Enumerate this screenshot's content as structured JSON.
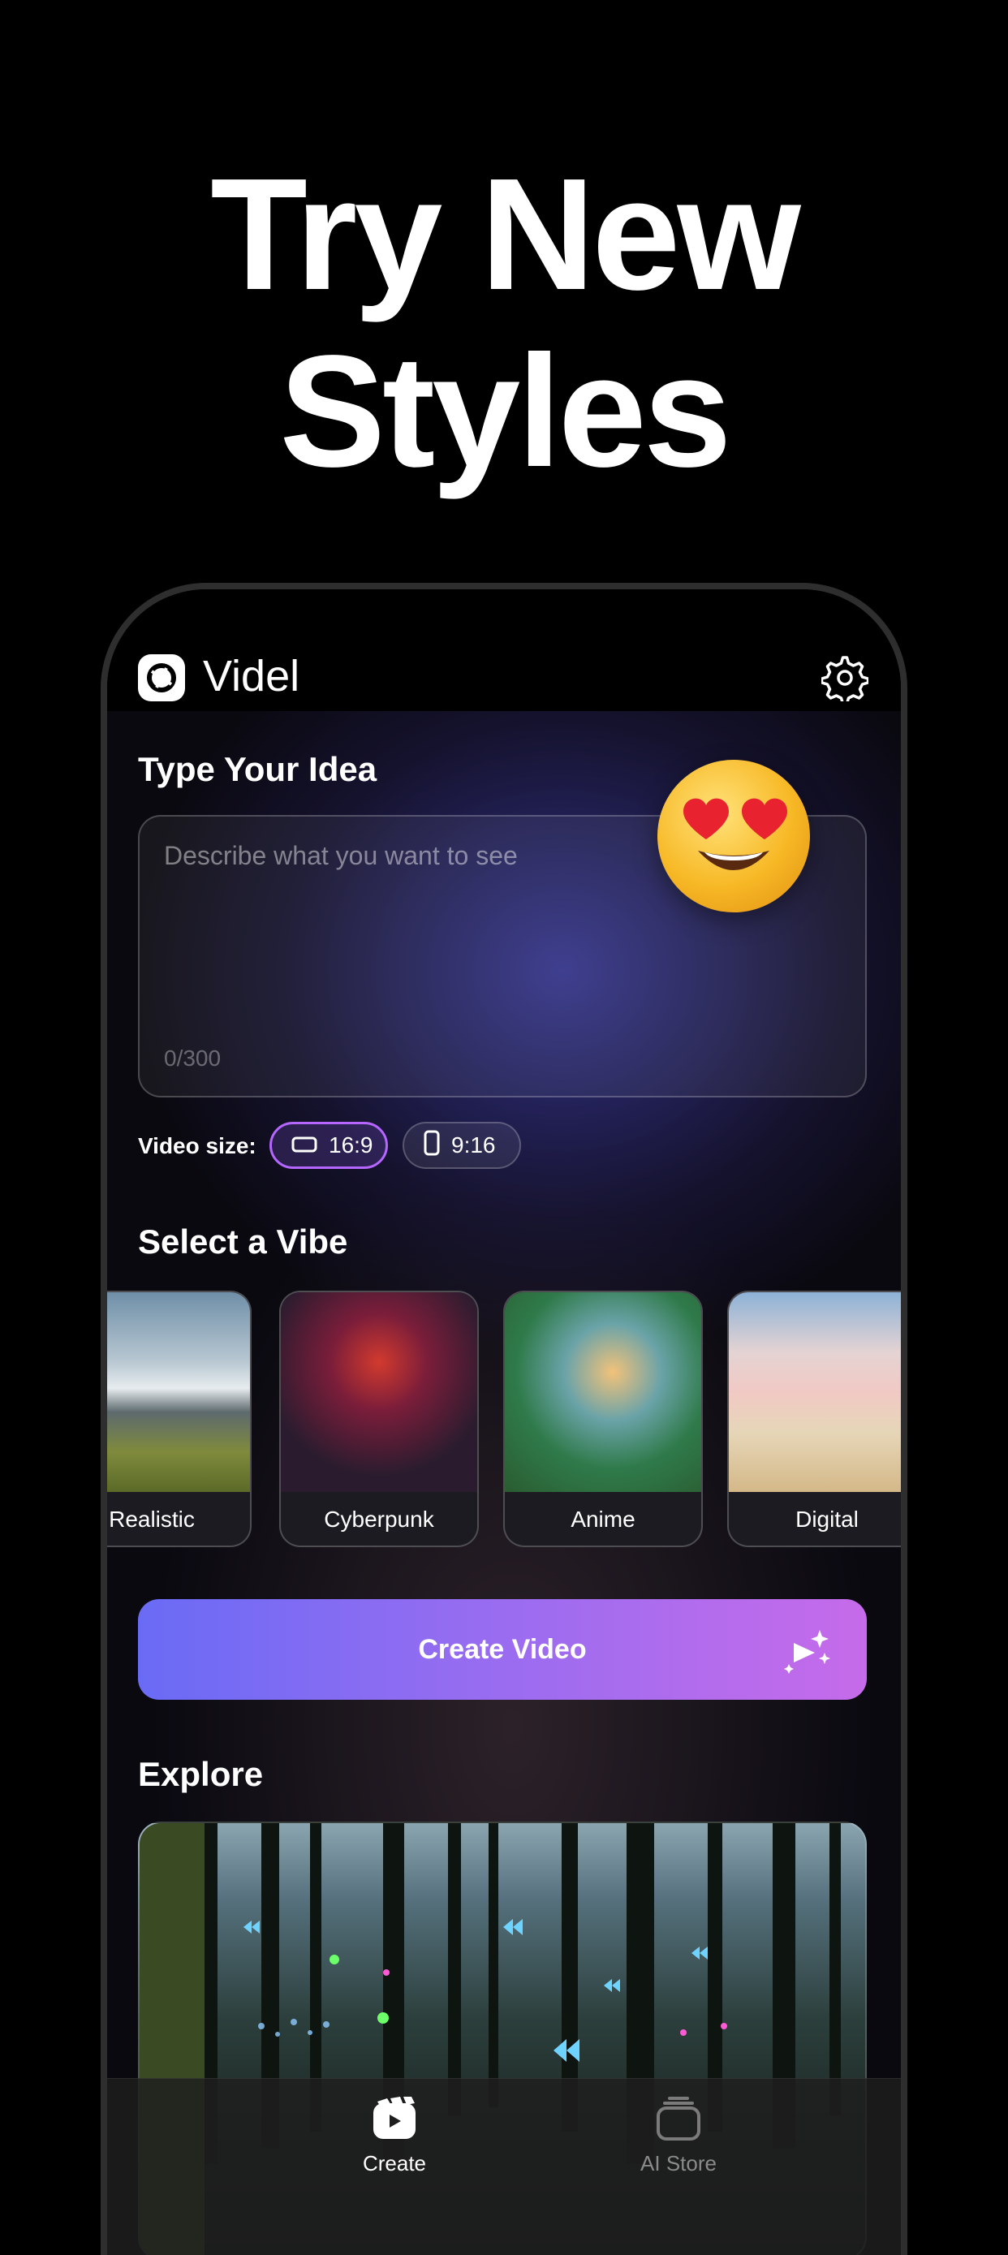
{
  "headline": {
    "line1": "Try New",
    "line2": "Styles"
  },
  "app": {
    "name": "Videl",
    "logo_icon": "videl-logo-icon",
    "settings_icon": "gear-icon"
  },
  "idea": {
    "title": "Type Your Idea",
    "placeholder": "Describe what you want to see",
    "value": "",
    "counter": "0/300",
    "sticker": "heart-eyes-emoji"
  },
  "video_size": {
    "label": "Video size:",
    "options": [
      {
        "label": "16:9",
        "icon": "landscape-icon",
        "selected": true
      },
      {
        "label": "9:16",
        "icon": "portrait-icon",
        "selected": false
      }
    ]
  },
  "vibe": {
    "title": "Select a Vibe",
    "items": [
      {
        "label": "Realistic"
      },
      {
        "label": "Cyberpunk"
      },
      {
        "label": "Anime"
      },
      {
        "label": "Digital"
      }
    ]
  },
  "create_button": {
    "label": "Create Video",
    "icon": "sparkle-play-icon"
  },
  "explore": {
    "title": "Explore"
  },
  "tabs": [
    {
      "label": "Create",
      "icon": "create-tab-icon",
      "active": true
    },
    {
      "label": "AI Store",
      "icon": "store-tab-icon",
      "active": false
    }
  ],
  "colors": {
    "accent_start": "#6a6bf5",
    "accent_end": "#c66bea",
    "selected_border": "#b566ff"
  }
}
